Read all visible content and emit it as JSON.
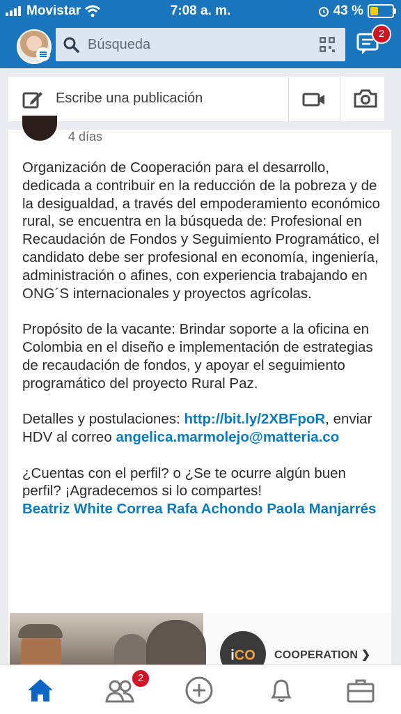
{
  "status_bar": {
    "carrier": "Movistar",
    "time": "7:08 a. m.",
    "battery": "43 %",
    "battery_level": 0.43
  },
  "header": {
    "search_placeholder": "Búsqueda",
    "messages_badge": "2"
  },
  "composer": {
    "label": "Escribe una publicación"
  },
  "post": {
    "age": "4 días",
    "paragraphs": [
      "Organización de Cooperación para el desarrollo, dedicada a contribuir  en la reducción de la pobreza y de la desigualdad, a través del empoderamiento económico rural, se encuentra en la búsqueda de: Profesional en Recaudación de Fondos y Seguimiento Programático, el candidato debe ser profesional en economía, ingeniería, administración o afines, con experiencia trabajando en ONG´S internacionales y proyectos agrícolas.",
      "Propósito de la vacante: Brindar soporte a la oficina en Colombia en el diseño e implementación de estrategias de recaudación de fondos, y apoyar el seguimiento programático del proyecto Rural Paz."
    ],
    "details_prefix": "Detalles y postulaciones: ",
    "details_link": "http://bit.ly/2XBFpoR",
    "details_mid": ", enviar HDV al correo ",
    "email": "angelica.marmolejo@matteria.co",
    "question": "¿Cuentas con el perfil? o ¿Se te ocurre algún buen perfil? ¡Agradecemos si lo compartes!",
    "mentions": "Beatriz White Correa Rafa Achondo Paola Manjarrés"
  },
  "promo": {
    "logo_text_a": "i",
    "logo_text_b": "CO",
    "cta": "COOPERATION ❯"
  },
  "bottom_nav": {
    "network_badge": "2"
  },
  "colors": {
    "header_blue": "#1b75bc",
    "link_blue": "#0b7bbf",
    "badge_red": "#d11124",
    "battery_yellow": "#ffcc00"
  }
}
